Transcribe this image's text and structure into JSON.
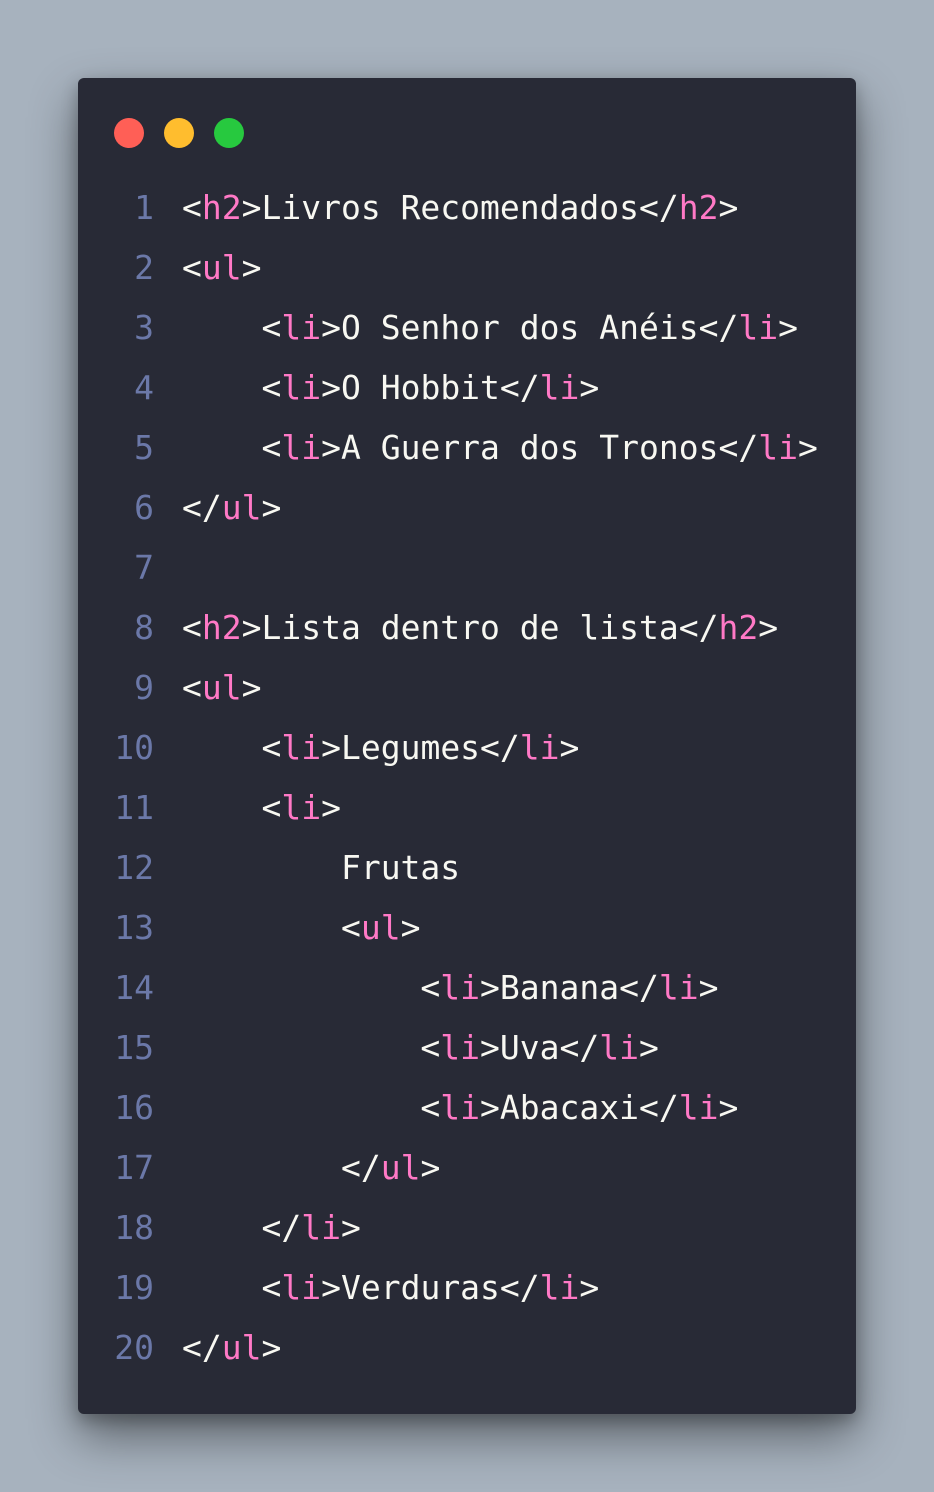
{
  "window": {
    "controls": [
      {
        "name": "close-dot",
        "color": "#ff5f56"
      },
      {
        "name": "minimize-dot",
        "color": "#ffbd2e"
      },
      {
        "name": "maximize-dot",
        "color": "#27c93f"
      }
    ]
  },
  "colors": {
    "background": "#a7b2be",
    "editor": "#282a36",
    "text": "#f8f8f2",
    "tag": "#ff79c6",
    "line_number": "#6b78a8"
  },
  "code": {
    "lines": [
      {
        "number": "1",
        "indent": "",
        "tokens": [
          {
            "t": "p",
            "v": "<"
          },
          {
            "t": "k",
            "v": "h2"
          },
          {
            "t": "p",
            "v": ">Livros Recomendados</"
          },
          {
            "t": "k",
            "v": "h2"
          },
          {
            "t": "p",
            "v": ">"
          }
        ]
      },
      {
        "number": "2",
        "indent": "",
        "tokens": [
          {
            "t": "p",
            "v": "<"
          },
          {
            "t": "k",
            "v": "ul"
          },
          {
            "t": "p",
            "v": ">"
          }
        ]
      },
      {
        "number": "3",
        "indent": "    ",
        "tokens": [
          {
            "t": "p",
            "v": "<"
          },
          {
            "t": "k",
            "v": "li"
          },
          {
            "t": "p",
            "v": ">O Senhor dos Anéis</"
          },
          {
            "t": "k",
            "v": "li"
          },
          {
            "t": "p",
            "v": ">"
          }
        ]
      },
      {
        "number": "4",
        "indent": "    ",
        "tokens": [
          {
            "t": "p",
            "v": "<"
          },
          {
            "t": "k",
            "v": "li"
          },
          {
            "t": "p",
            "v": ">O Hobbit</"
          },
          {
            "t": "k",
            "v": "li"
          },
          {
            "t": "p",
            "v": ">"
          }
        ]
      },
      {
        "number": "5",
        "indent": "    ",
        "tokens": [
          {
            "t": "p",
            "v": "<"
          },
          {
            "t": "k",
            "v": "li"
          },
          {
            "t": "p",
            "v": ">A Guerra dos Tronos</"
          },
          {
            "t": "k",
            "v": "li"
          },
          {
            "t": "p",
            "v": ">"
          }
        ]
      },
      {
        "number": "6",
        "indent": "",
        "tokens": [
          {
            "t": "p",
            "v": "</"
          },
          {
            "t": "k",
            "v": "ul"
          },
          {
            "t": "p",
            "v": ">"
          }
        ]
      },
      {
        "number": "7",
        "indent": "",
        "tokens": []
      },
      {
        "number": "8",
        "indent": "",
        "tokens": [
          {
            "t": "p",
            "v": "<"
          },
          {
            "t": "k",
            "v": "h2"
          },
          {
            "t": "p",
            "v": ">Lista dentro de lista</"
          },
          {
            "t": "k",
            "v": "h2"
          },
          {
            "t": "p",
            "v": ">"
          }
        ]
      },
      {
        "number": "9",
        "indent": "",
        "tokens": [
          {
            "t": "p",
            "v": "<"
          },
          {
            "t": "k",
            "v": "ul"
          },
          {
            "t": "p",
            "v": ">"
          }
        ]
      },
      {
        "number": "10",
        "indent": "    ",
        "tokens": [
          {
            "t": "p",
            "v": "<"
          },
          {
            "t": "k",
            "v": "li"
          },
          {
            "t": "p",
            "v": ">Legumes</"
          },
          {
            "t": "k",
            "v": "li"
          },
          {
            "t": "p",
            "v": ">"
          }
        ]
      },
      {
        "number": "11",
        "indent": "    ",
        "tokens": [
          {
            "t": "p",
            "v": "<"
          },
          {
            "t": "k",
            "v": "li"
          },
          {
            "t": "p",
            "v": ">"
          }
        ]
      },
      {
        "number": "12",
        "indent": "        ",
        "tokens": [
          {
            "t": "p",
            "v": "Frutas"
          }
        ]
      },
      {
        "number": "13",
        "indent": "        ",
        "tokens": [
          {
            "t": "p",
            "v": "<"
          },
          {
            "t": "k",
            "v": "ul"
          },
          {
            "t": "p",
            "v": ">"
          }
        ]
      },
      {
        "number": "14",
        "indent": "            ",
        "tokens": [
          {
            "t": "p",
            "v": "<"
          },
          {
            "t": "k",
            "v": "li"
          },
          {
            "t": "p",
            "v": ">Banana</"
          },
          {
            "t": "k",
            "v": "li"
          },
          {
            "t": "p",
            "v": ">"
          }
        ]
      },
      {
        "number": "15",
        "indent": "            ",
        "tokens": [
          {
            "t": "p",
            "v": "<"
          },
          {
            "t": "k",
            "v": "li"
          },
          {
            "t": "p",
            "v": ">Uva</"
          },
          {
            "t": "k",
            "v": "li"
          },
          {
            "t": "p",
            "v": ">"
          }
        ]
      },
      {
        "number": "16",
        "indent": "            ",
        "tokens": [
          {
            "t": "p",
            "v": "<"
          },
          {
            "t": "k",
            "v": "li"
          },
          {
            "t": "p",
            "v": ">Abacaxi</"
          },
          {
            "t": "k",
            "v": "li"
          },
          {
            "t": "p",
            "v": ">"
          }
        ]
      },
      {
        "number": "17",
        "indent": "        ",
        "tokens": [
          {
            "t": "p",
            "v": "</"
          },
          {
            "t": "k",
            "v": "ul"
          },
          {
            "t": "p",
            "v": ">"
          }
        ]
      },
      {
        "number": "18",
        "indent": "    ",
        "tokens": [
          {
            "t": "p",
            "v": "</"
          },
          {
            "t": "k",
            "v": "li"
          },
          {
            "t": "p",
            "v": ">"
          }
        ]
      },
      {
        "number": "19",
        "indent": "    ",
        "tokens": [
          {
            "t": "p",
            "v": "<"
          },
          {
            "t": "k",
            "v": "li"
          },
          {
            "t": "p",
            "v": ">Verduras</"
          },
          {
            "t": "k",
            "v": "li"
          },
          {
            "t": "p",
            "v": ">"
          }
        ]
      },
      {
        "number": "20",
        "indent": "",
        "tokens": [
          {
            "t": "p",
            "v": "</"
          },
          {
            "t": "k",
            "v": "ul"
          },
          {
            "t": "p",
            "v": ">"
          }
        ]
      }
    ]
  }
}
